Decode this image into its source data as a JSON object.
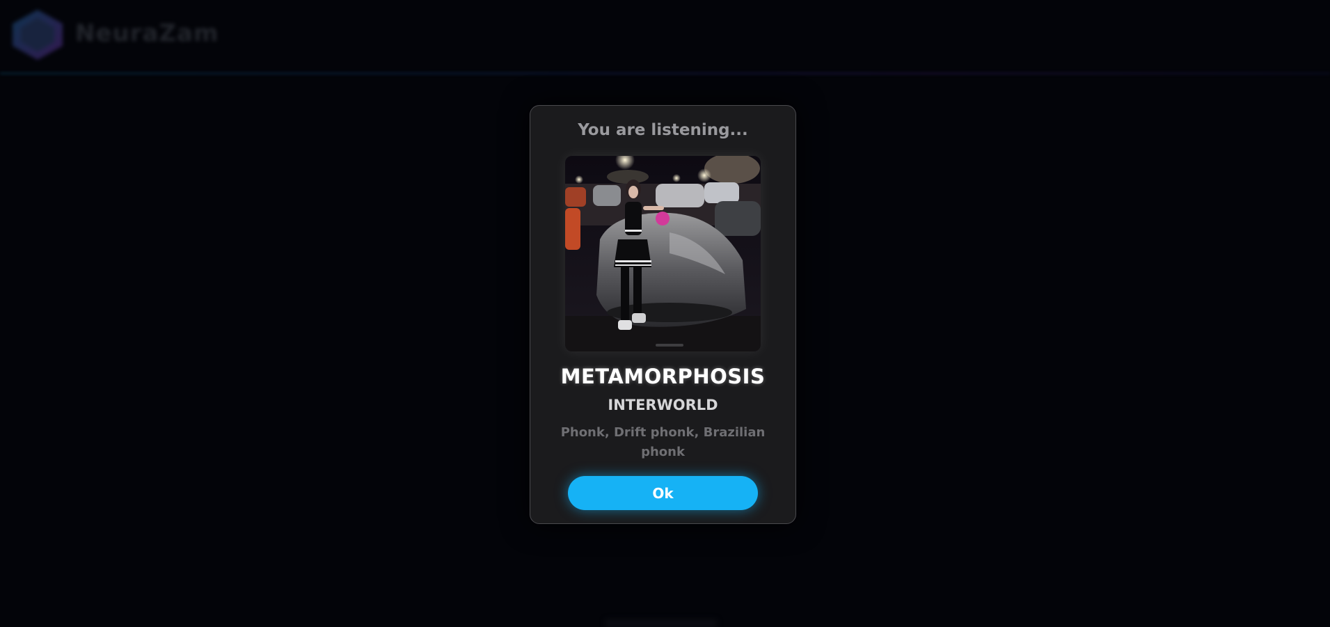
{
  "header": {
    "logo_text": "NeuraZam",
    "logo_icon": "neurazam-logo-icon"
  },
  "modal": {
    "title": "You are listening...",
    "cover_image": "album-cover-art",
    "track_title": "METAMORPHOSIS",
    "artist": "INTERWORLD",
    "genres": "Phonk, Drift phonk, Brazilian phonk",
    "ok_label": "Ok"
  },
  "colors": {
    "background": "#030409",
    "modal_bg": "#1b1b1d",
    "accent": "#16b2f5"
  }
}
